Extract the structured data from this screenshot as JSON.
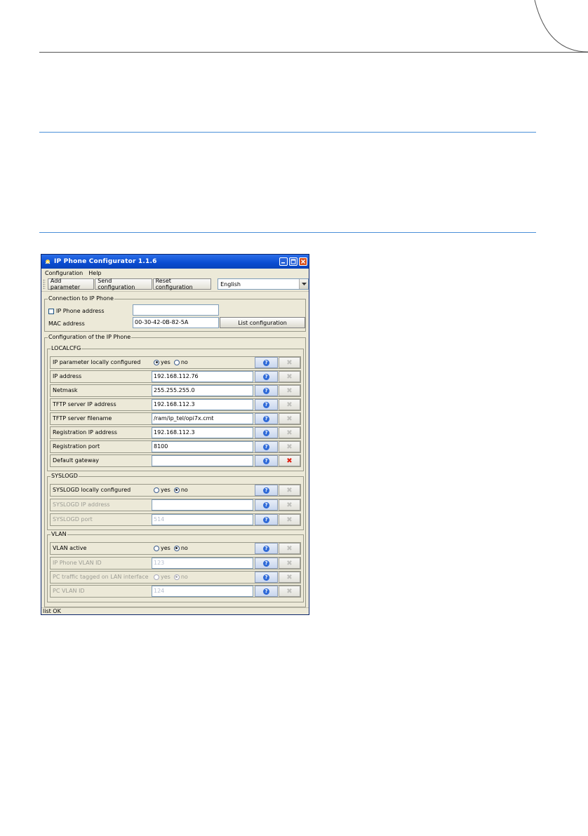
{
  "window": {
    "title": "IP Phone Configurator 1.1.6"
  },
  "menu": [
    "Configuration",
    "Help"
  ],
  "toolbar": {
    "add_parameter": "Add parameter",
    "send_configuration": "Send configuration",
    "reset_configuration": "Reset configuration",
    "language": "English"
  },
  "connection": {
    "legend": "Connection to IP Phone",
    "ip_phone_address_label": "IP Phone address",
    "ip_phone_address_value": "",
    "mac_address_label": "MAC address",
    "mac_address_value": "00-30-42-0B-82-5A",
    "list_configuration": "List configuration"
  },
  "configuration": {
    "legend": "Configuration of the IP Phone",
    "localcfg": {
      "legend": "LOCALCFG",
      "rows": [
        {
          "label": "IP parameter locally configured",
          "yes": "yes",
          "no": "no"
        },
        {
          "label": "IP address",
          "value": "192.168.112.76"
        },
        {
          "label": "Netmask",
          "value": "255.255.255.0"
        },
        {
          "label": "TFTP server IP address",
          "value": "192.168.112.3"
        },
        {
          "label": "TFTP server filename",
          "value": "/ram/ip_tel/opi7x.cmt"
        },
        {
          "label": "Registration IP address",
          "value": "192.168.112.3"
        },
        {
          "label": "Registration port",
          "value": "8100"
        },
        {
          "label": "Default gateway",
          "value": ""
        }
      ]
    },
    "syslogd": {
      "legend": "SYSLOGD",
      "rows": [
        {
          "label": "SYSLOGD locally configured",
          "yes": "yes",
          "no": "no"
        },
        {
          "label": "SYSLOGD IP address",
          "value": ""
        },
        {
          "label": "SYSLOGD port",
          "value": "514"
        }
      ]
    },
    "vlan": {
      "legend": "VLAN",
      "rows": [
        {
          "label": "VLAN active",
          "yes": "yes",
          "no": "no"
        },
        {
          "label": "IP Phone VLAN ID",
          "value": "123"
        },
        {
          "label": "PC traffic tagged on LAN interface",
          "yes": "yes",
          "no": "no"
        },
        {
          "label": "PC VLAN ID",
          "value": "124"
        }
      ]
    }
  },
  "status": "list OK",
  "help_glyph": "?",
  "delete_glyph": "✖",
  "icons": {
    "help": "help-icon",
    "delete": "delete-icon"
  }
}
